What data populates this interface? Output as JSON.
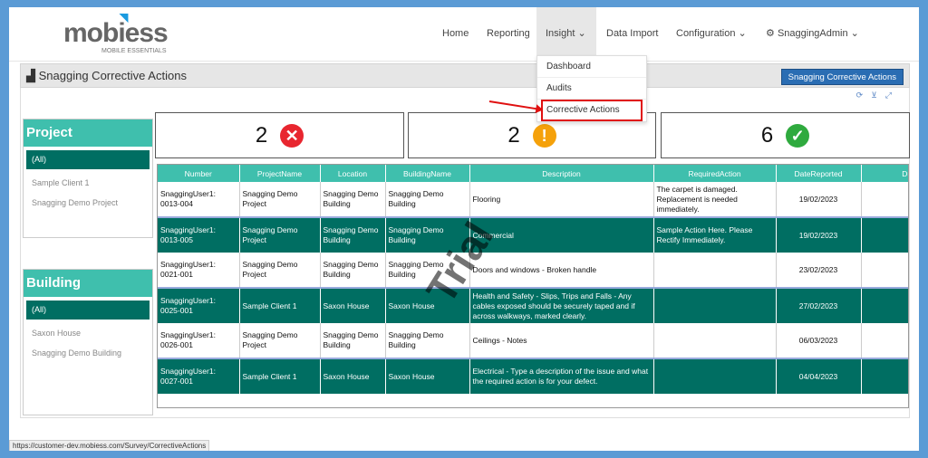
{
  "brand": {
    "name": "mobiess",
    "tagline": "MOBILE ESSENTIALS"
  },
  "nav": {
    "home": "Home",
    "reporting": "Reporting",
    "insight": "Insight",
    "data_import": "Data Import",
    "configuration": "Configuration",
    "user": "SnaggingAdmin"
  },
  "insight_menu": [
    "Dashboard",
    "Audits",
    "Corrective Actions"
  ],
  "panel": {
    "title": "Snagging Corrective Actions",
    "button": "Snagging Corrective Actions"
  },
  "filters": {
    "project": {
      "title": "Project",
      "items": [
        "(All)",
        "Sample Client 1",
        "Snagging Demo Project"
      ]
    },
    "building": {
      "title": "Building",
      "items": [
        "(All)",
        "Saxon House",
        "Snagging Demo Building"
      ]
    }
  },
  "cards": [
    {
      "value": "2",
      "color": "#e8262f"
    },
    {
      "value": "2",
      "color": "#f5a10a"
    },
    {
      "value": "6",
      "color": "#2faa3e"
    }
  ],
  "table": {
    "headers": [
      "Number",
      "ProjectName",
      "Location",
      "BuildingName",
      "Description",
      "RequiredAction",
      "DateReported",
      "DueDate"
    ],
    "rows": [
      [
        "SnaggingUser1: 0013-004",
        "Snagging Demo Project",
        "Snagging Demo Building",
        "Snagging Demo Building",
        "Flooring",
        "The carpet is damaged. Replacement is needed immediately.",
        "19/02/2023",
        ""
      ],
      [
        "SnaggingUser1: 0013-005",
        "Snagging Demo Project",
        "Snagging Demo Building",
        "Snagging Demo Building",
        "Commercial",
        "Sample Action Here. Please Rectify Immediately.",
        "19/02/2023",
        ""
      ],
      [
        "SnaggingUser1: 0021-001",
        "Snagging Demo Project",
        "Snagging Demo Building",
        "Snagging Demo Building",
        "Doors and windows - Broken handle",
        "",
        "23/02/2023",
        ""
      ],
      [
        "SnaggingUser1: 0025-001",
        "Sample Client 1",
        "Saxon House",
        "Saxon House",
        "Health and Safety - Slips, Trips and Falls - Any cables exposed should be securely taped and if across walkways, marked clearly.",
        "",
        "27/02/2023",
        ""
      ],
      [
        "SnaggingUser1: 0026-001",
        "Snagging Demo Project",
        "Snagging Demo Building",
        "Snagging Demo Building",
        "Ceilings - Notes",
        "",
        "06/03/2023",
        ""
      ],
      [
        "SnaggingUser1: 0027-001",
        "Sample Client 1",
        "Saxon House",
        "Saxon House",
        "Electrical - Type a description of the issue and what the required action is for your defect.",
        "",
        "04/04/2023",
        ""
      ]
    ]
  },
  "watermark": "Trial",
  "status_url": "https://customer-dev.mobiess.com/Survey/CorrectiveActions"
}
